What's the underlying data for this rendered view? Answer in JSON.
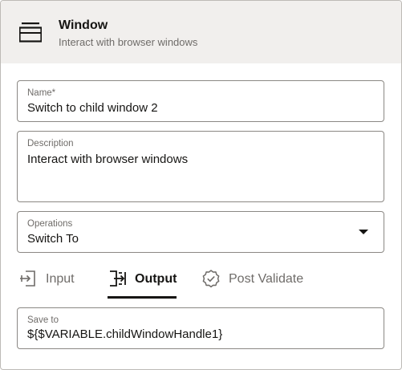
{
  "header": {
    "title": "Window",
    "subtitle": "Interact with browser windows",
    "icon": "window-icon"
  },
  "fields": {
    "name": {
      "label": "Name*",
      "value": "Switch to child window 2"
    },
    "description": {
      "label": "Description",
      "value": "Interact with browser windows"
    },
    "operations": {
      "label": "Operations",
      "value": "Switch To"
    },
    "save_to": {
      "label": "Save to",
      "value": "${$VARIABLE.childWindowHandle1}"
    }
  },
  "tabs": [
    {
      "label": "Input",
      "icon": "input-icon",
      "active": false
    },
    {
      "label": "Output",
      "icon": "output-icon",
      "active": true
    },
    {
      "label": "Post Validate",
      "icon": "post-validate-icon",
      "active": false
    }
  ],
  "colors": {
    "header_bg": "#f1efed",
    "text": "#161513",
    "muted": "#6f6c69",
    "border": "#8b8884"
  }
}
